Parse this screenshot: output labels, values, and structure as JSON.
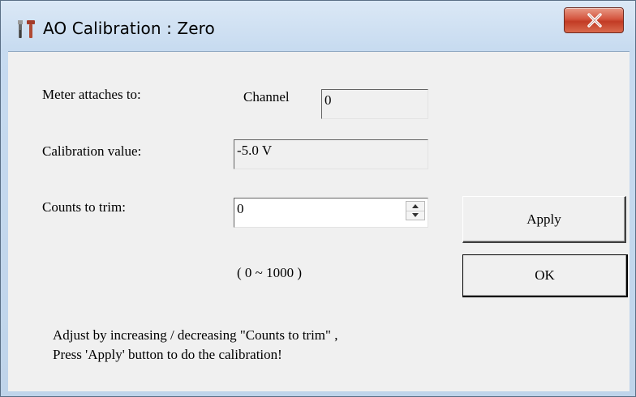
{
  "window": {
    "title": "AO Calibration : Zero",
    "close_icon": "close-icon",
    "title_icon": "tools-icon"
  },
  "form": {
    "meter_label": "Meter attaches to:",
    "channel_label": "Channel",
    "channel_value": "0",
    "calibration_label": "Calibration value:",
    "calibration_value": "-5.0 V",
    "counts_label": "Counts to trim:",
    "counts_value": "0",
    "range_text": "( 0 ~ 1000 )"
  },
  "buttons": {
    "apply_label": "Apply",
    "ok_label": "OK"
  },
  "instructions": {
    "line1": "Adjust by increasing / decreasing \"Counts to trim\" ,",
    "line2": "Press 'Apply' button to do the calibration!"
  },
  "colors": {
    "close_button": "#c9432b",
    "dialog_background": "#f0f0f0"
  }
}
